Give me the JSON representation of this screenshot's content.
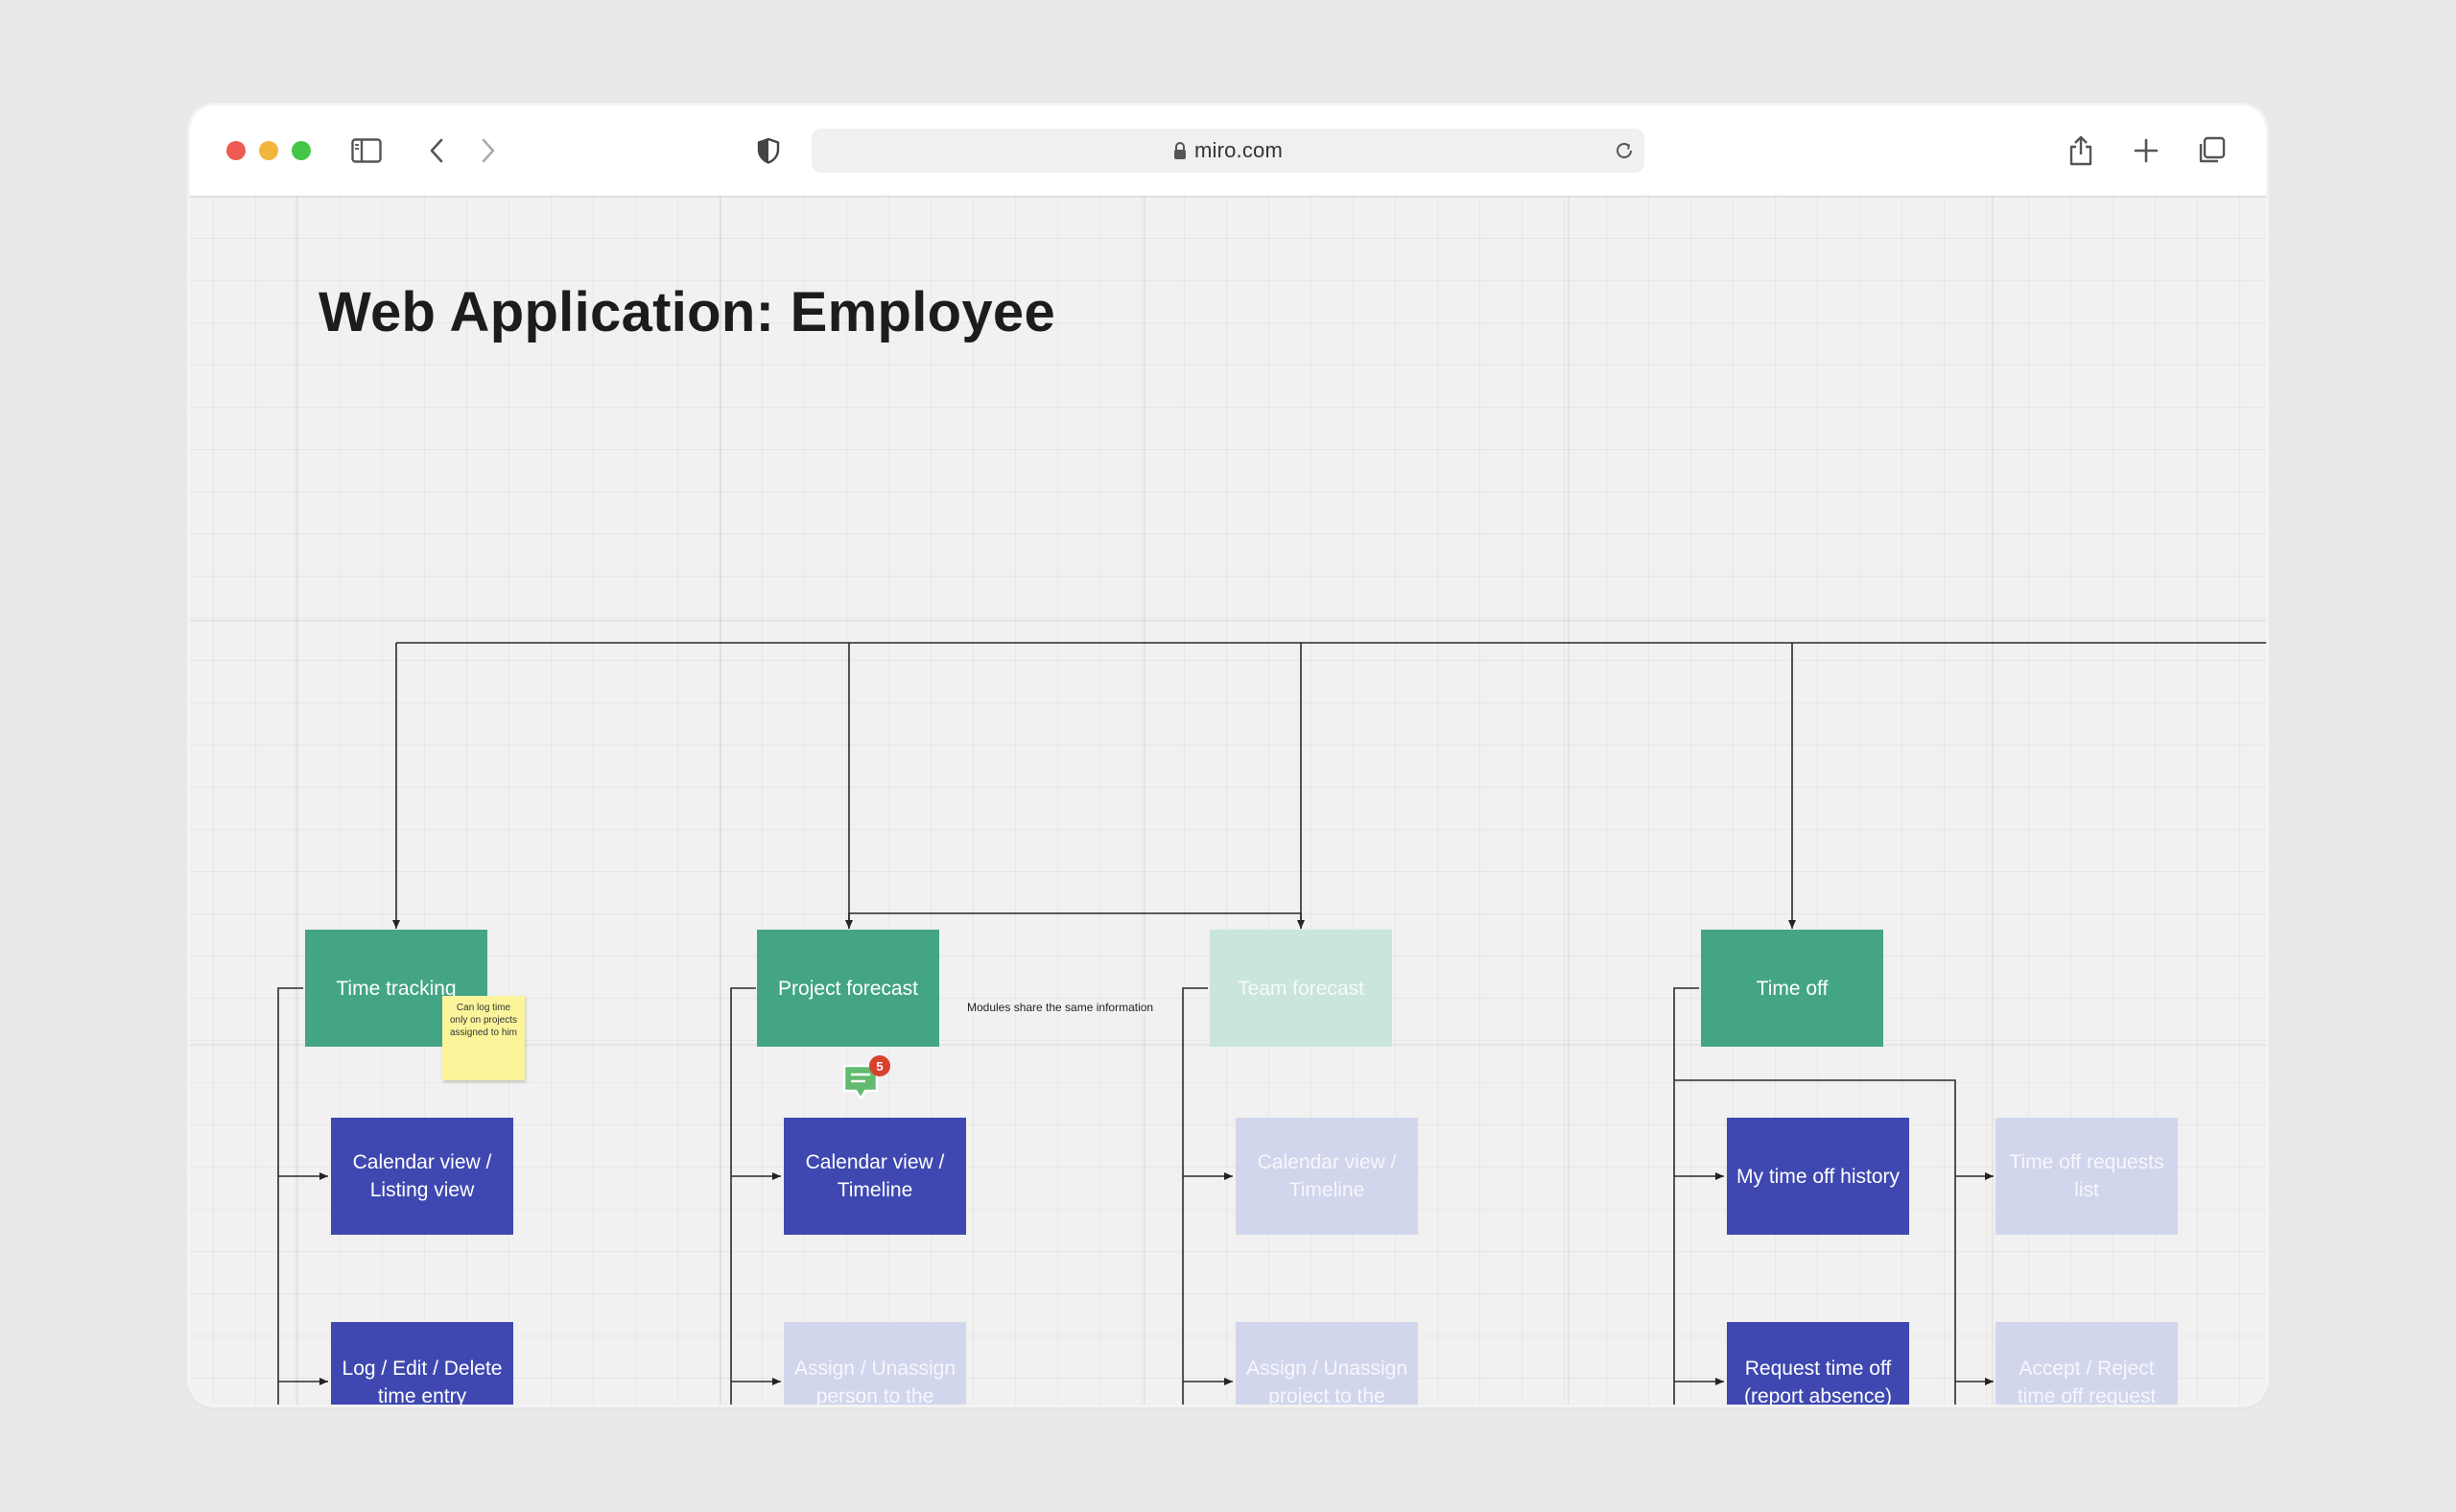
{
  "browser": {
    "url": "miro.com",
    "traffic_light_colors": {
      "close": "#ee5b52",
      "minimize": "#f3b63c",
      "maximize": "#43c645"
    }
  },
  "board": {
    "title": "Web Application: Employee",
    "sticky_note": "Can log time only on projects assigned to him",
    "connector_label": "Modules share the same information",
    "comment_count": "5",
    "modules": [
      {
        "label": "Time tracking",
        "children": [
          "Calendar view / Listing view",
          "Log / Edit / Delete time entry"
        ]
      },
      {
        "label": "Project forecast",
        "children": [
          "Calendar view / Timeline",
          "Assign / Unassign person to the"
        ]
      },
      {
        "label": "Team forecast",
        "children": [
          "Calendar view / Timeline",
          "Assign / Unassign project to the"
        ]
      },
      {
        "label": "Time off",
        "children": [
          "My time off history",
          "Request time off (report absence)",
          "Time off requests list",
          "Accept / Reject time off request"
        ]
      }
    ]
  },
  "colors": {
    "module": "#44a586",
    "module_faded": "#c9e5dc",
    "feature": "#3f48b0",
    "feature_faded": "#d2d6ec",
    "sticky": "#fbf49b",
    "comment_badge": "#d9412f"
  }
}
